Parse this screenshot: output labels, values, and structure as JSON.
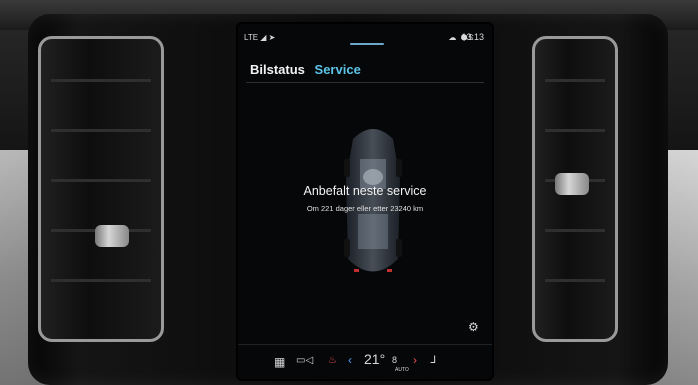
{
  "status_bar": {
    "left_icons": "LTE ◢ ➤",
    "right_icons": "☁ ⬢5",
    "time": "13:13"
  },
  "tabs": [
    {
      "label": "Bilstatus",
      "active": true
    },
    {
      "label": "Service",
      "active": false
    }
  ],
  "service": {
    "title": "Anbefalt neste service",
    "subtitle": "Om 221 dager eller etter 23240 km"
  },
  "climate": {
    "temperature": "21°",
    "fan_level": "8",
    "fan_mode": "AUTO"
  },
  "bottom_icons": {
    "apps": "▦",
    "camera": "▭◁",
    "seat_heat_left": "♨",
    "chevron_left": "‹",
    "chevron_right": "›",
    "seat_right": "ᒧ",
    "settings": "⚙"
  },
  "colors": {
    "accent_tab": "#5cc3e6",
    "accent_red": "#e85050",
    "accent_blue": "#4fa2ff"
  }
}
